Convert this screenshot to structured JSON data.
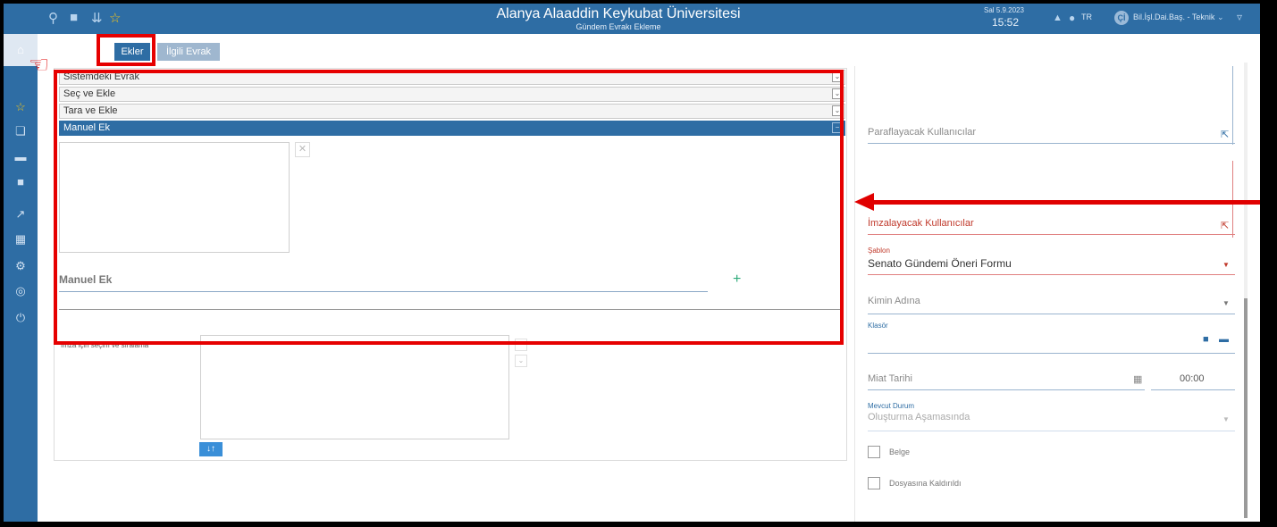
{
  "window": {
    "title": "Alanya Alaaddin Keykubat Üniversitesi",
    "subtitle": "Gündem Evrakı Ekleme",
    "date": "Sal 5.9.2023",
    "time": "15:52",
    "lang": "TR",
    "avatar": "Çİ",
    "user": "Bil.İşl.Dai.Baş. - Teknik"
  },
  "topbar_icons": [
    "search-icon",
    "briefcase-icon",
    "chevron-double-down-icon",
    "star-icon"
  ],
  "sidebar_icons": [
    "home-icon",
    "star-icon",
    "documents-icon",
    "folder-icon",
    "briefcase-icon",
    "chart-icon",
    "report-icon",
    "gear-icon",
    "globe-icon",
    "power-icon"
  ],
  "tabs": {
    "ekler": "Ekler",
    "ilgili": "İlgili Evrak"
  },
  "accordion": [
    "Sistemdeki Evrak",
    "Seç ve Ekle",
    "Tara ve Ekle",
    "Manuel Ek"
  ],
  "manuel_ek": {
    "label": "Manuel Ek",
    "add": "+"
  },
  "imza": {
    "label": "İmza için seçim ve sıralama",
    "sort": "↓↑"
  },
  "right": {
    "parafla": "Paraflayacak Kullanıcılar",
    "imzalayacak": "İmzalayacak Kullanıcılar",
    "sablon_label": "Şablon",
    "sablon_value": "Senato Gündemi Öneri Formu",
    "kimin_adina": "Kimin Adına",
    "klasor": "Klasör",
    "miat_tarihi": "Miat Tarihi",
    "miat_saat": "00:00",
    "mevcut_durum_label": "Mevcut Durum",
    "mevcut_durum_value": "Oluşturma Aşamasında",
    "belge": "Belge",
    "dosyasina": "Dosyasına Kaldırıldı"
  },
  "colors": {
    "primary": "#2e6da4",
    "annotation": "#e00000",
    "required": "#c0392b",
    "add": "#2eaa7a"
  }
}
